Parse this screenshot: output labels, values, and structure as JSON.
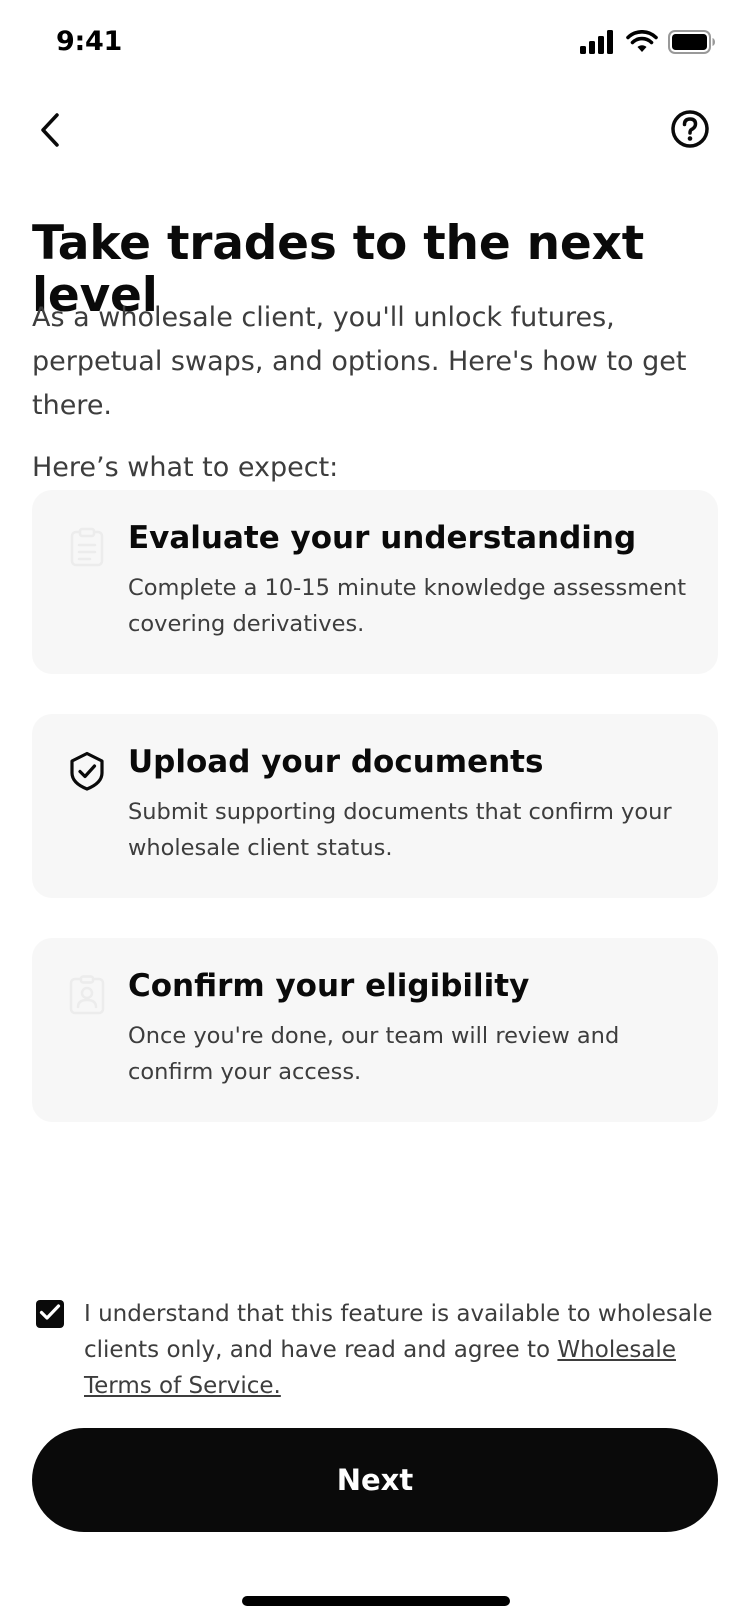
{
  "status_bar": {
    "time": "9:41",
    "icons": [
      "cellular-signal-icon",
      "wifi-icon",
      "battery-icon"
    ]
  },
  "nav": {
    "back_icon": "chevron-left-icon",
    "help_icon": "help-circle-icon"
  },
  "header": {
    "title": "Take trades to the next level",
    "subtitle": "As a wholesale client, you'll unlock futures, perpetual swaps, and options. Here's how to get there."
  },
  "steps": {
    "label": "Here’s what to expect:",
    "items": [
      {
        "icon": "clipboard-icon",
        "title": "Evaluate your understanding",
        "description": "Complete a 10-15 minute knowledge assessment covering derivatives."
      },
      {
        "icon": "shield-check-icon",
        "title": "Upload your documents",
        "description": "Submit supporting documents that confirm your wholesale client status."
      },
      {
        "icon": "id-badge-icon",
        "title": "Confirm your eligibility",
        "description": "Once you're done, our team will review and confirm your access."
      }
    ]
  },
  "consent": {
    "checked": true,
    "text": "I understand that this feature is available to wholesale clients only, and have read and agree to ",
    "link_text": "Wholesale Terms of Service."
  },
  "footer": {
    "next_label": "Next"
  },
  "colors": {
    "primary": "#0a0a0a",
    "card_bg": "#f7f7f7",
    "secondary_text": "#3d3d3d",
    "background": "#ffffff"
  }
}
